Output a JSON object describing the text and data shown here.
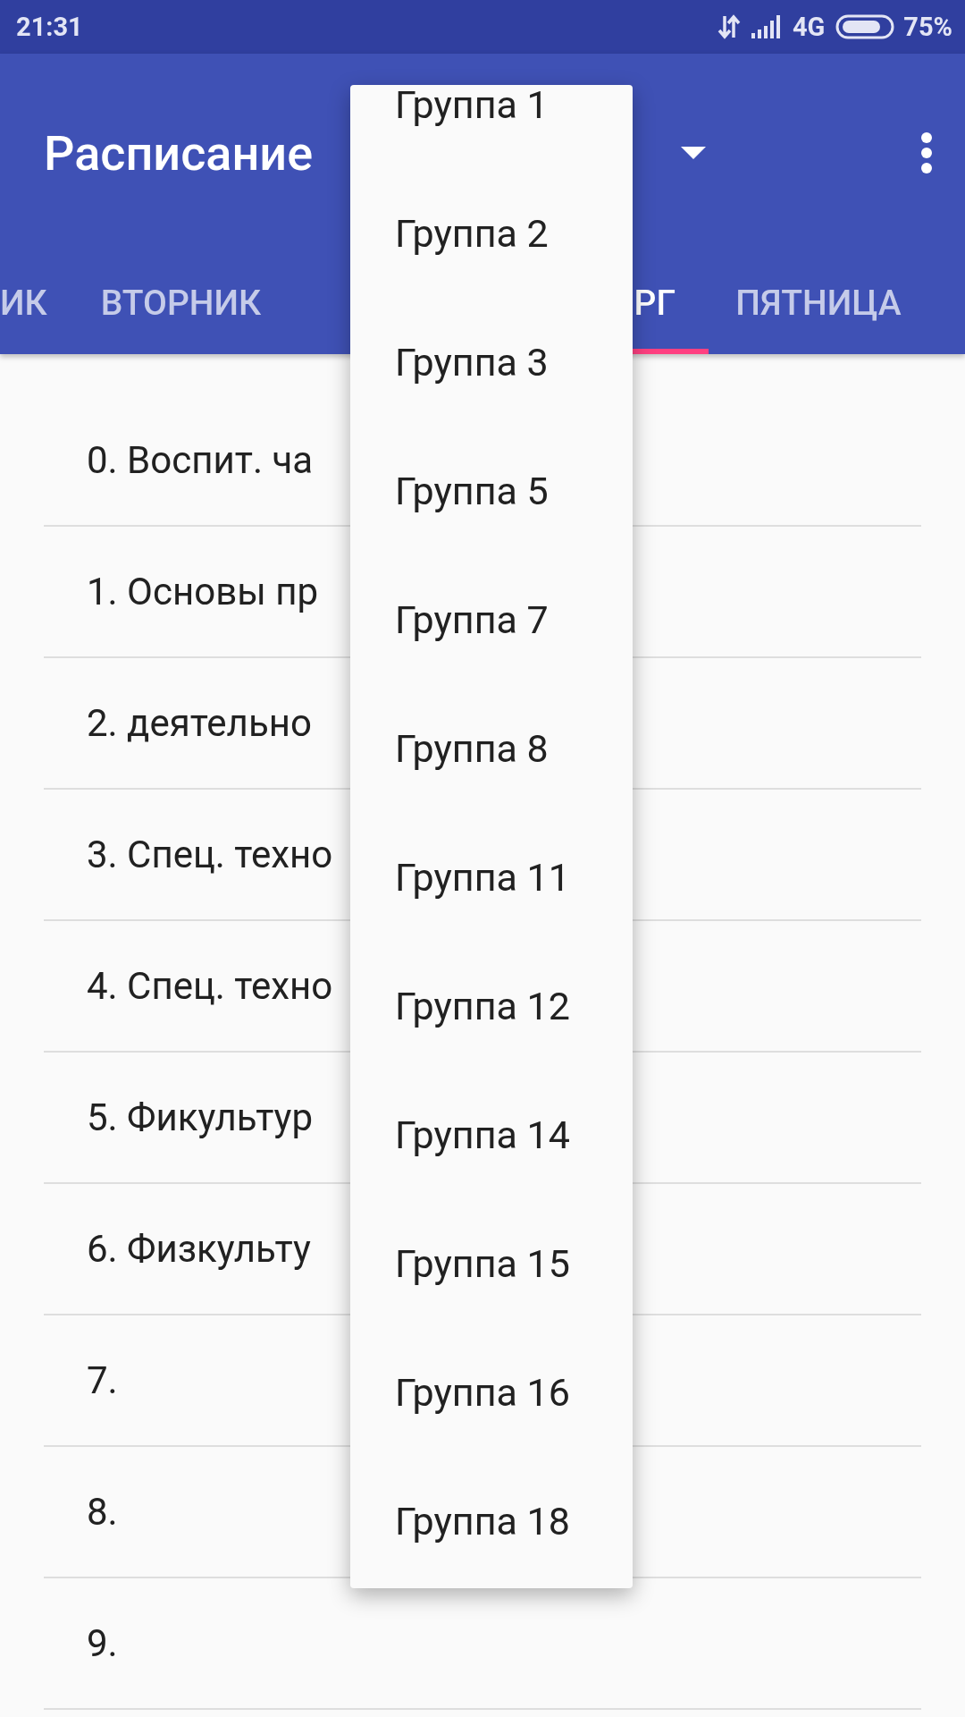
{
  "status_bar": {
    "time": "21:31",
    "network": "4G",
    "battery": "75%"
  },
  "toolbar": {
    "title": "Расписание"
  },
  "tabs": [
    {
      "label": "ИК",
      "selected": false
    },
    {
      "label": "ВТОРНИК",
      "selected": false
    },
    {
      "label": "РГ",
      "selected": true
    },
    {
      "label": "ПЯТНИЦА",
      "selected": false
    }
  ],
  "lessons": [
    "0. Воспит. ча",
    "1. Основы пр",
    "2. деятельно",
    "3. Спец. техно",
    "4. Спец. техно",
    "5. Фикультур",
    "6. Физкульту",
    "7.",
    "8.",
    "9."
  ],
  "dropdown": {
    "items": [
      "Группа 1",
      "Группа 2",
      "Группа 3",
      "Группа 5",
      "Группа 7",
      "Группа 8",
      "Группа 11",
      "Группа 12",
      "Группа 14",
      "Группа 15",
      "Группа 16",
      "Группа 18"
    ]
  }
}
